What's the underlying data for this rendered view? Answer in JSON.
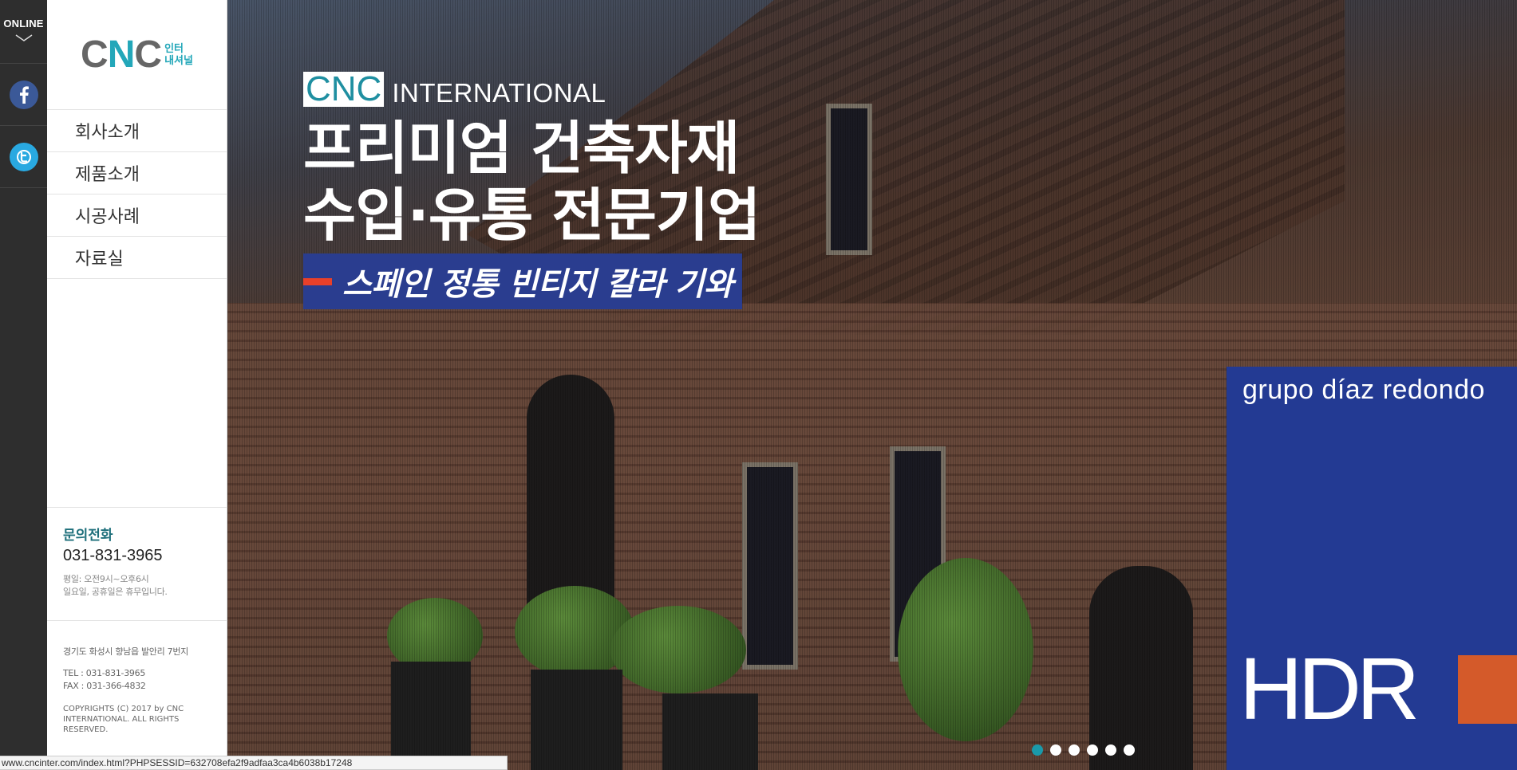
{
  "rail": {
    "online_label": "ONLINE",
    "facebook_icon": "facebook-icon",
    "twitter_icon": "twitter-icon",
    "facebook_color": "#3b5998",
    "twitter_color": "#29a9e1"
  },
  "sidebar": {
    "logo_text_1": "C",
    "logo_text_2": "N",
    "logo_text_3": "C",
    "logo_sub_1": "인터",
    "logo_sub_2": "내셔널",
    "nav": [
      {
        "label": "회사소개"
      },
      {
        "label": "제품소개"
      },
      {
        "label": "시공사례"
      },
      {
        "label": "자료실"
      }
    ],
    "contact_title": "문의전화",
    "contact_phone": "031-831-3965",
    "hours_1": "평일: 오전9시~오후6시",
    "hours_2": "일요일, 공휴일은 휴무입니다.",
    "address": "경기도 화성시 향남읍 발안리 7번지",
    "tel": "TEL : 031-831-3965",
    "fax": "FAX : 031-366-4832",
    "copyright": "COPYRIGHTS (C) 2017 by CNC INTERNATIONAL. ALL RIGHTS RESERVED."
  },
  "hero": {
    "brand_cnc": "CNC",
    "brand_intl": "INTERNATIONAL",
    "headline_1": "프리미엄 건축자재",
    "headline_2": "수입·유통 전문기업",
    "ribbon": "스페인 정통 빈티지 칼라 기와",
    "card_brand": "grupo díaz redondo",
    "card_logo": "HDR",
    "accent_color": "#233a93",
    "slide_count": 6,
    "active_slide": 1
  },
  "statusbar": {
    "url": "www.cncinter.com/index.html?PHPSESSID=632708efa2f9adfaa3ca4b6038b17248"
  }
}
